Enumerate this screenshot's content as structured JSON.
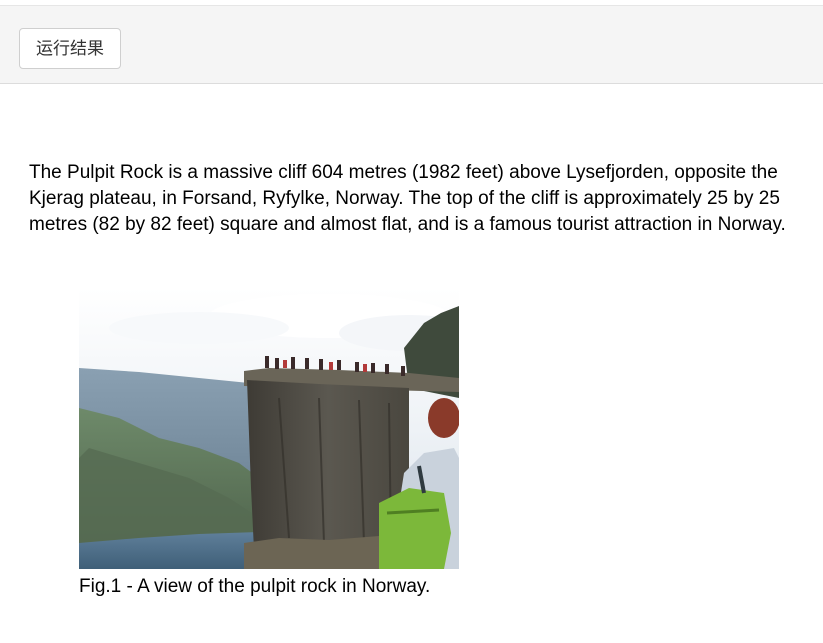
{
  "toolbar": {
    "run_button_label": "运行结果"
  },
  "article": {
    "paragraph": "The Pulpit Rock is a massive cliff 604 metres (1982 feet) above Lysefjorden, opposite the Kjerag plateau, in Forsand, Ryfylke, Norway. The top of the cliff is approximately 25 by 25 metres (82 by 82 feet) square and almost flat, and is a famous tourist attraction in Norway."
  },
  "figure": {
    "caption": "Fig.1 - A view of the pulpit rock in Norway."
  },
  "colors": {
    "toolbar_bg": "#f5f5f5",
    "button_border": "#cfcfcf",
    "text": "#000000"
  }
}
